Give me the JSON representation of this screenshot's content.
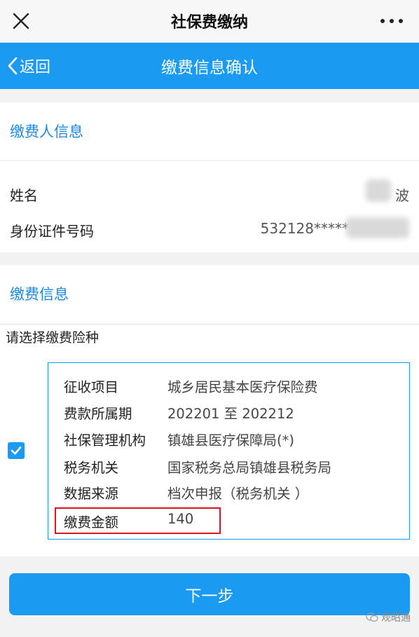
{
  "topbar": {
    "title": "社保费缴纳"
  },
  "navbar": {
    "back_label": "返回",
    "title": "缴费信息确认"
  },
  "payer_section": {
    "title": "缴费人信息",
    "name_label": "姓名",
    "name_value": "波",
    "id_label": "身份证件号码",
    "id_value": "532128*****"
  },
  "payment_section": {
    "title": "缴费信息",
    "prompt": "请选择缴费险种",
    "checkbox_checked": true,
    "items": [
      {
        "label": "征收项目",
        "value": "城乡居民基本医疗保险费"
      },
      {
        "label": "费款所属期",
        "value": "202201 至 202212"
      },
      {
        "label": "社保管理机构",
        "value": "镇雄县医疗保障局(*)"
      },
      {
        "label": "税务机关",
        "value": "国家税务总局镇雄县税务局"
      },
      {
        "label": "数据来源",
        "value": "档次申报（税务机关 ）"
      },
      {
        "label": "缴费金额",
        "value": "140"
      }
    ]
  },
  "next_button": {
    "label": "下一步"
  },
  "watermark": {
    "text": "观昭通"
  },
  "colors": {
    "accent": "#1a9af0",
    "section_title": "#1a8ae6",
    "highlight": "#e0141e"
  }
}
